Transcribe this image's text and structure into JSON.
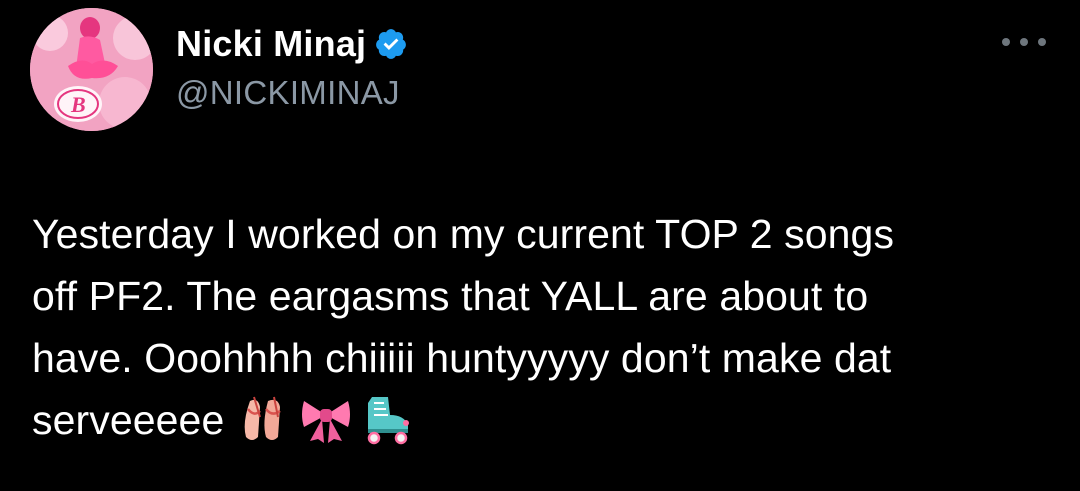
{
  "user": {
    "display_name": "Nicki Minaj",
    "handle": "@NICKIMINAJ",
    "verified": true,
    "avatar_icon": "barbie-avatar"
  },
  "menu": {
    "icon": "more-options-icon"
  },
  "tweet": {
    "lines": [
      "Yesterday I worked on my current TOP 2 songs",
      "off PF2. The eargasms that YALL are about to",
      "have. Ooohhhh chiiiii huntyyyyy don’t make dat",
      "serveeeee"
    ],
    "emojis": [
      "ballet-shoes-emoji",
      "ribbon-emoji",
      "roller-skate-emoji"
    ]
  },
  "colors": {
    "background": "#000000",
    "text": "#ffffff",
    "secondary_text": "#8b98a5",
    "verified_blue": "#1d9bf0"
  }
}
